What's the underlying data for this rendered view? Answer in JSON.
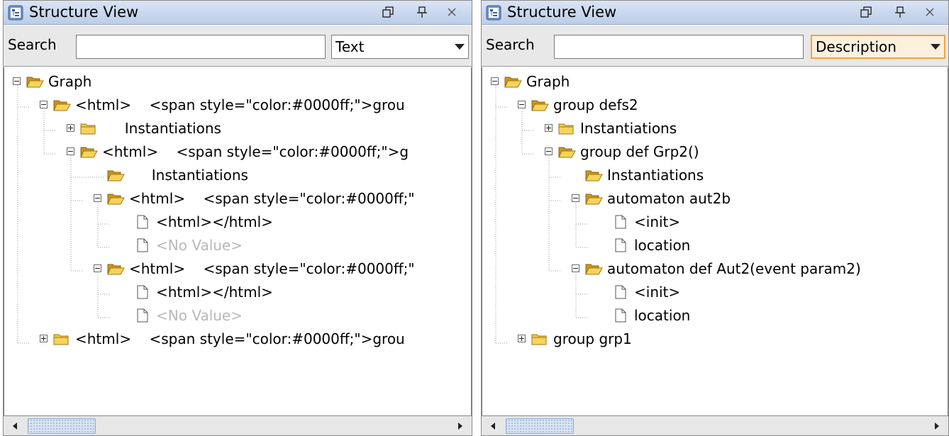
{
  "panels": [
    {
      "title": "Structure View",
      "search_label": "Search",
      "search_value": "",
      "select_value": "Text",
      "tree": [
        {
          "label": "Graph",
          "toggle": "minus",
          "icon": "folder-open-icon",
          "style": "normal"
        },
        {
          "label": "<html>    <span style=\"color:#0000ff;\">grou",
          "toggle": "minus",
          "icon": "folder-open-icon",
          "style": "normal"
        },
        {
          "label": "     Instantiations",
          "toggle": "plus",
          "icon": "folder-closed-icon",
          "style": "normal"
        },
        {
          "label": "<html>    <span style=\"color:#0000ff;\">g",
          "toggle": "minus",
          "icon": "folder-open-icon",
          "style": "normal"
        },
        {
          "label": "     Instantiations",
          "toggle": "none",
          "icon": "folder-open-icon",
          "style": "normal"
        },
        {
          "label": "<html>    <span style=\"color:#0000ff;\"",
          "toggle": "minus",
          "icon": "folder-open-icon",
          "style": "normal"
        },
        {
          "label": "<html></html>",
          "toggle": "none",
          "icon": "file-icon",
          "style": "normal"
        },
        {
          "label": "<No Value>",
          "toggle": "none",
          "icon": "file-icon",
          "style": "novalue"
        },
        {
          "label": "<html>    <span style=\"color:#0000ff;\"",
          "toggle": "minus",
          "icon": "folder-open-icon",
          "style": "normal"
        },
        {
          "label": "<html></html>",
          "toggle": "none",
          "icon": "file-icon",
          "style": "normal"
        },
        {
          "label": "<No Value>",
          "toggle": "none",
          "icon": "file-icon",
          "style": "novalue"
        },
        {
          "label": "<html>    <span style=\"color:#0000ff;\">grou",
          "toggle": "plus",
          "icon": "folder-closed-icon",
          "style": "normal"
        }
      ]
    },
    {
      "title": "Structure View",
      "search_label": "Search",
      "search_value": "",
      "select_value": "Description",
      "tree": [
        {
          "label": "Graph",
          "toggle": "minus",
          "icon": "folder-open-icon",
          "style": "normal"
        },
        {
          "label": "group defs2",
          "toggle": "minus",
          "icon": "folder-open-icon",
          "style": "normal"
        },
        {
          "label": "Instantiations",
          "toggle": "plus",
          "icon": "folder-closed-icon",
          "style": "normal"
        },
        {
          "label": "group def Grp2()",
          "toggle": "minus",
          "icon": "folder-open-icon",
          "style": "normal"
        },
        {
          "label": "Instantiations",
          "toggle": "none",
          "icon": "folder-open-icon",
          "style": "normal"
        },
        {
          "label": "automaton aut2b",
          "toggle": "minus",
          "icon": "folder-open-icon",
          "style": "normal"
        },
        {
          "label": "<init>",
          "toggle": "none",
          "icon": "file-icon",
          "style": "normal"
        },
        {
          "label": "location",
          "toggle": "none",
          "icon": "file-icon",
          "style": "normal"
        },
        {
          "label": "automaton def Aut2(event param2)",
          "toggle": "minus",
          "icon": "folder-open-icon",
          "style": "normal"
        },
        {
          "label": "<init>",
          "toggle": "none",
          "icon": "file-icon",
          "style": "normal"
        },
        {
          "label": "location",
          "toggle": "none",
          "icon": "file-icon",
          "style": "normal"
        },
        {
          "label": "group grp1",
          "toggle": "plus",
          "icon": "folder-closed-icon",
          "style": "normal"
        }
      ]
    }
  ],
  "colors": {
    "titlebar": "#c6d5ec",
    "folder": "#f0c94a",
    "folder_dark": "#c9951c",
    "novalue_text": "#b8b8b8",
    "focus_border": "#f2a23a"
  }
}
